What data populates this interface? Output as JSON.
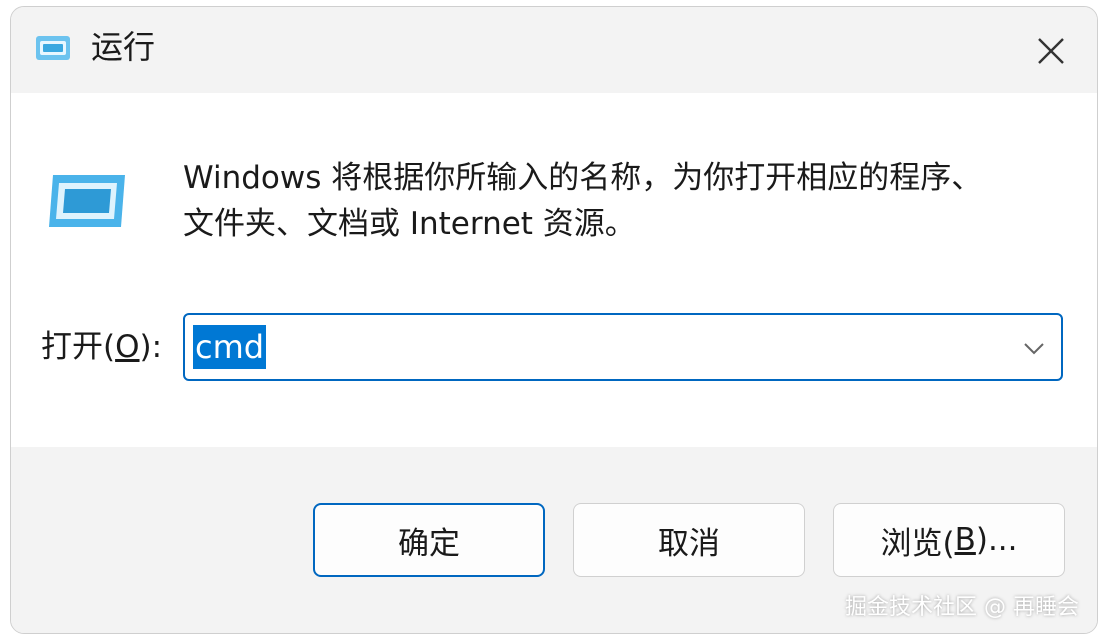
{
  "window": {
    "title": "运行",
    "close_label": "✕"
  },
  "description": {
    "line1": "Windows 将根据你所输入的名称，为你打开相应的程序、",
    "line2": "文件夹、文档或 Internet 资源。"
  },
  "open_field": {
    "label_prefix": "打开(",
    "label_accel": "O",
    "label_suffix": "):",
    "value": "cmd"
  },
  "buttons": {
    "ok_label": "确定",
    "cancel_label": "取消",
    "browse_prefix": "浏览(",
    "browse_accel": "B",
    "browse_suffix": ")..."
  },
  "watermark": "掘金技术社区 @ 再睡会",
  "colors": {
    "accent": "#0067c0",
    "selection": "#0078d4",
    "titlebar": "#f3f3f3",
    "content": "#ffffff"
  },
  "icons": {
    "title_icon": "run-dialog-icon",
    "content_icon": "run-dialog-icon",
    "close_icon": "close-icon",
    "dropdown_icon": "chevron-down-icon"
  }
}
